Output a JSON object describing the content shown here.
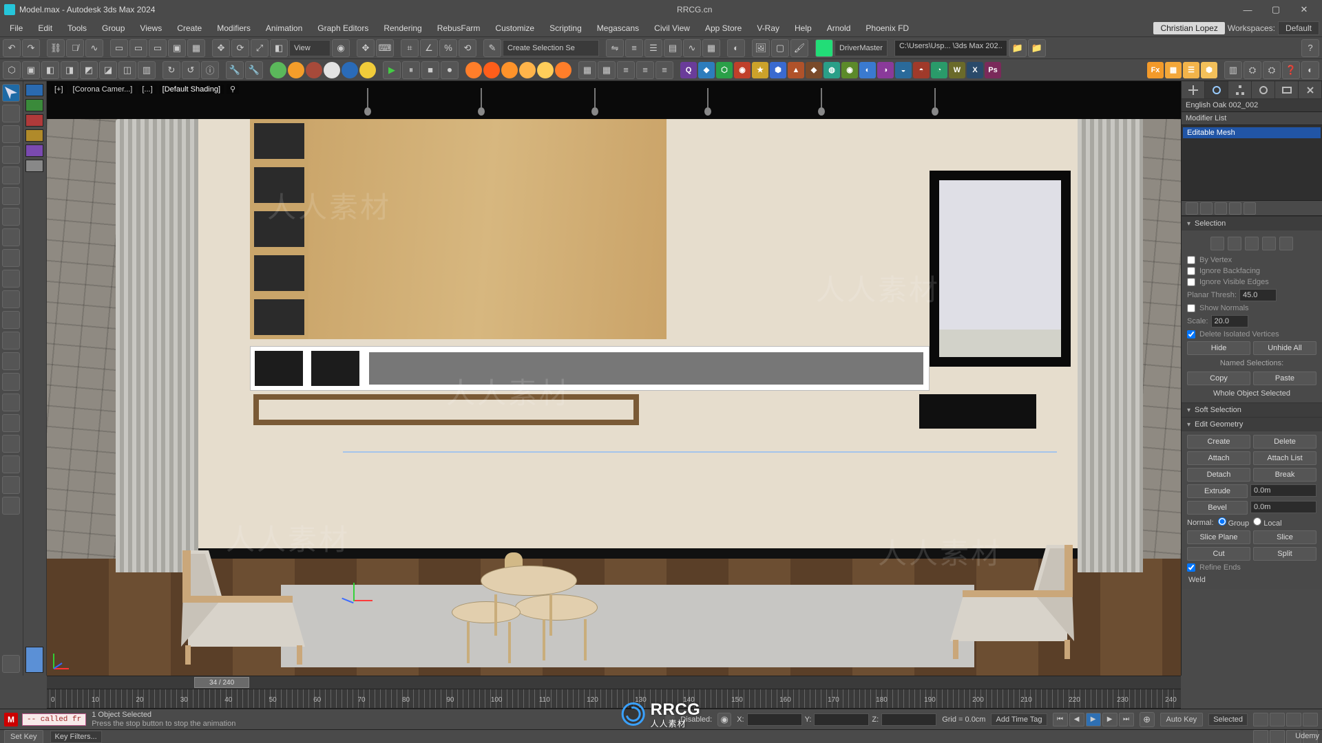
{
  "title": "Model.max - Autodesk 3ds Max 2024",
  "top_center_url": "RRCG.cn",
  "window_buttons": {
    "min": "—",
    "max": "▢",
    "close": "✕"
  },
  "menus": [
    "File",
    "Edit",
    "Tools",
    "Group",
    "Views",
    "Create",
    "Modifiers",
    "Animation",
    "Graph Editors",
    "Rendering",
    "RebusFarm",
    "Customize",
    "Scripting",
    "Megascans",
    "Civil View",
    "App Store",
    "V-Ray",
    "Help",
    "Arnold",
    "Phoenix FD"
  ],
  "workspace": {
    "user": "Christian Lopez",
    "label": "Workspaces:",
    "value": "Default"
  },
  "maintool": {
    "view_dd": "View",
    "selset_dd": "Create Selection Se",
    "drivermaster": "DriverMaster",
    "path": "C:\\Users\\Usp...  \\3ds Max 202.."
  },
  "viewport": {
    "labels": [
      "[+]",
      "[Corona Camer...]",
      "[...]",
      "[Default Shading]"
    ],
    "time_label": "34 / 240"
  },
  "timeline": {
    "min": 0,
    "max": 240,
    "current": 34,
    "ticks": [
      "0",
      "10",
      "20",
      "30",
      "40",
      "50",
      "60",
      "70",
      "80",
      "90",
      "100",
      "110",
      "120",
      "130",
      "140",
      "150",
      "160",
      "170",
      "180",
      "190",
      "200",
      "210",
      "220",
      "230",
      "240"
    ]
  },
  "right_panel": {
    "tabs": [
      "create",
      "modify",
      "hierarchy",
      "motion",
      "display",
      "utilities"
    ],
    "object_name": "English Oak 002_002",
    "modifier_title": "Modifier List",
    "modifier_items": [
      "Editable Mesh"
    ],
    "selection": {
      "title": "Selection",
      "by_vertex": "By Vertex",
      "ignore_backfacing": "Ignore Backfacing",
      "ignore_visible_edges": "Ignore Visible Edges",
      "planar_thresh_label": "Planar Thresh:",
      "planar_thresh_value": "45.0",
      "show_normals": "Show Normals",
      "scale_label": "Scale:",
      "scale_value": "20.0",
      "delete_isolated": "Delete Isolated Vertices",
      "hide": "Hide",
      "unhide": "Unhide All",
      "named_sel": "Named Selections:",
      "copy": "Copy",
      "paste": "Paste",
      "whole": "Whole Object Selected"
    },
    "soft_selection": {
      "title": "Soft Selection"
    },
    "edit_geometry": {
      "title": "Edit Geometry",
      "create": "Create",
      "delete": "Delete",
      "attach": "Attach",
      "attach_list": "Attach List",
      "detach": "Detach",
      "break": "Break",
      "extrude": "Extrude",
      "extrude_val": "0.0m",
      "bevel": "Bevel",
      "bevel_val": "0.0m",
      "normal": "Normal:",
      "group": "Group",
      "local": "Local",
      "slice_plane": "Slice Plane",
      "slice": "Slice",
      "cut": "Cut",
      "split": "Split",
      "refine_ends": "Refine Ends",
      "weld": "Weld"
    }
  },
  "status": {
    "script": "-- called fr",
    "selected": "1 Object Selected",
    "hint": "Press the stop button to stop the animation",
    "disable_label": "Disabled:",
    "x": "X:",
    "y": "Y:",
    "z": "Z:",
    "grid": "Grid = 0.0cm",
    "add_time_tag": "Add Time Tag",
    "auto_key": "Auto Key",
    "set_key": "Set Key",
    "selected_dd": "Selected",
    "key_filters": "Key Filters..."
  },
  "watermark": {
    "brand": "RRCG",
    "sub": "人人素材",
    "url": "RRCG.cn",
    "faint": "人人素材"
  },
  "corner_mark": "Udemy"
}
